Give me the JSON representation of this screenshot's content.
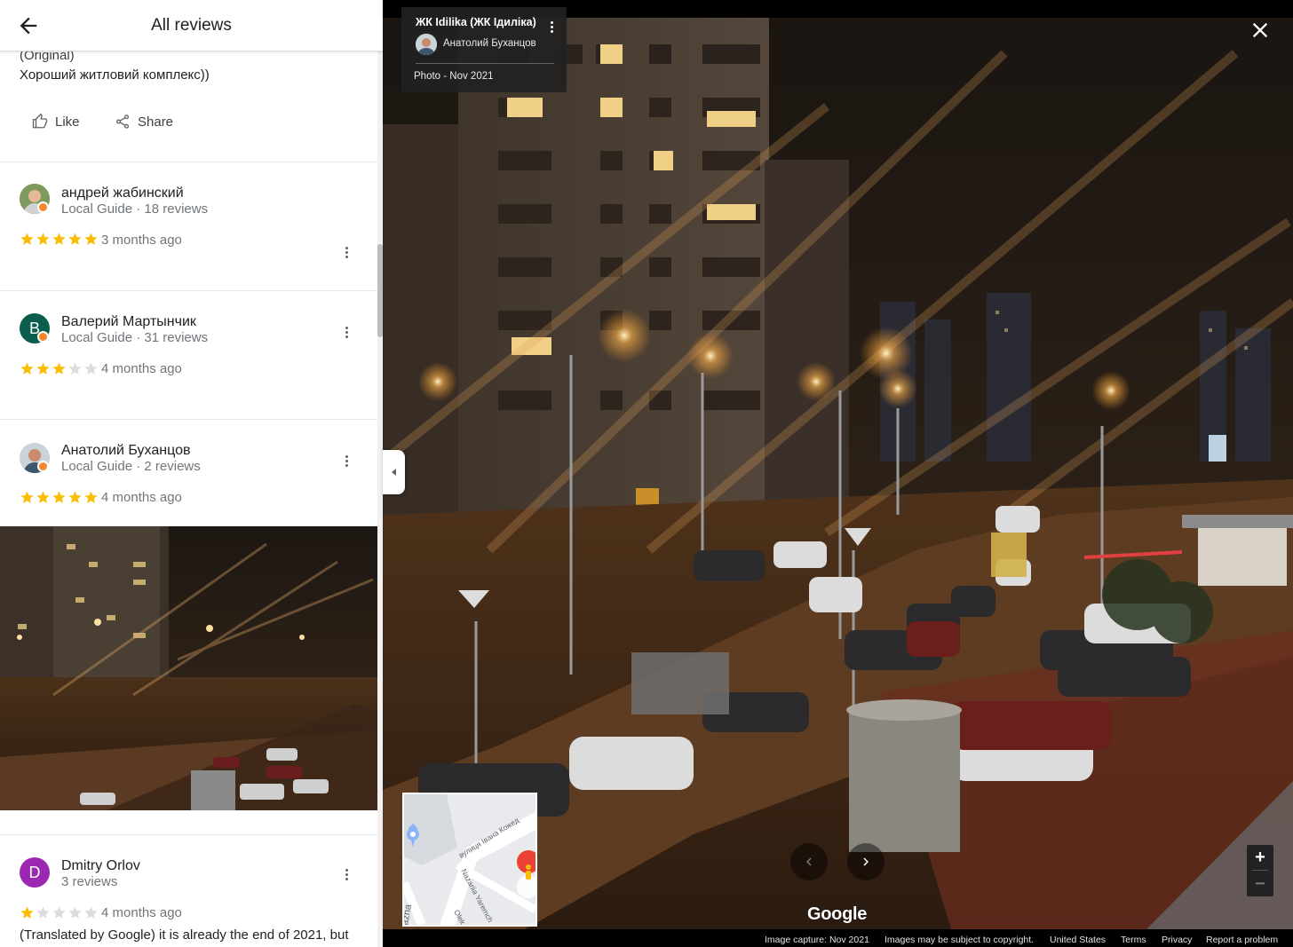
{
  "panel": {
    "title": "All reviews",
    "original_label": "(Original)",
    "original_text": "Хороший житловий комплекс))",
    "like_label": "Like",
    "share_label": "Share"
  },
  "reviews": [
    {
      "name": "андрей жабинский",
      "meta": "Local Guide · 18 reviews",
      "rating": 5,
      "time": "3 months ago",
      "avatar_type": "photo",
      "local_guide": true
    },
    {
      "name": "Валерий Мартынчик",
      "meta": "Local Guide · 31 reviews",
      "rating": 3,
      "time": "4 months ago",
      "avatar_type": "letter",
      "avatar_letter": "В",
      "avatar_color": "#0b5e4d",
      "local_guide": true
    },
    {
      "name": "Анатолий Буханцов",
      "meta": "Local Guide · 2 reviews",
      "rating": 5,
      "time": "4 months ago",
      "avatar_type": "photo",
      "local_guide": true
    },
    {
      "name": "Dmitry Orlov",
      "meta": "3 reviews",
      "rating": 1,
      "time": "4 months ago",
      "avatar_type": "letter",
      "avatar_letter": "D",
      "avatar_color": "#9c27b0",
      "local_guide": false,
      "text": "(Translated by Google) it is already the end of 2021, but"
    }
  ],
  "viewer": {
    "place_name": "ЖК Idilika (ЖК Ідиліка)",
    "author": "Анатолий Буханцов",
    "photo_date": "Photo - Nov 2021",
    "brand": "Google",
    "zoom_in": "+",
    "zoom_out": "−",
    "map_labels": {
      "street1": "вулиця Івана Кожед",
      "street2": "Nazariia Yaremch",
      "street3": "Olek",
      "street4": "ažna"
    },
    "footer": {
      "capture": "Image capture: Nov 2021",
      "copyright": "Images may be subject to copyright.",
      "country": "United States",
      "terms": "Terms",
      "privacy": "Privacy",
      "report": "Report a problem"
    }
  },
  "colors": {
    "star_filled": "#fbbc04",
    "star_empty": "#dadce0",
    "guide_badge": "#f4862b",
    "pin_red": "#ea4335"
  },
  "icons": [
    "back-arrow-icon",
    "thumb-up-icon",
    "share-icon",
    "more-vert-icon",
    "star-icon",
    "close-icon",
    "chevron-left-icon",
    "chevron-right-icon",
    "map-pin-icon",
    "pegman-icon"
  ]
}
